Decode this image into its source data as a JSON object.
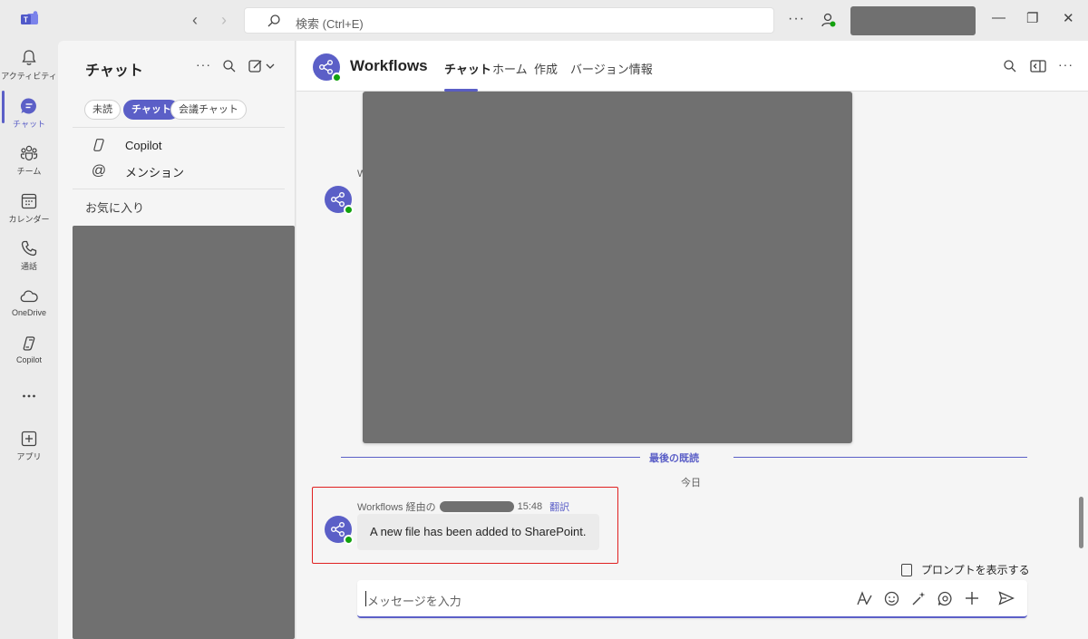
{
  "titlebar": {
    "search_placeholder": "検索 (Ctrl+E)",
    "more": "···",
    "minimize": "—",
    "restore": "❐",
    "close": "✕"
  },
  "rail": {
    "items": [
      {
        "label": "アクティビティ",
        "icon": "bell-icon"
      },
      {
        "label": "チャット",
        "icon": "chat-icon",
        "active": true
      },
      {
        "label": "チーム",
        "icon": "teams-icon"
      },
      {
        "label": "カレンダー",
        "icon": "calendar-icon"
      },
      {
        "label": "通話",
        "icon": "phone-icon"
      },
      {
        "label": "OneDrive",
        "icon": "cloud-icon"
      },
      {
        "label": "Copilot",
        "icon": "copilot-icon"
      },
      {
        "label": "",
        "icon": "more-icon"
      },
      {
        "label": "アプリ",
        "icon": "apps-icon"
      }
    ]
  },
  "panel": {
    "title": "チャット",
    "filters": [
      "未読",
      "チャット",
      "会議チャット"
    ],
    "special": [
      {
        "label": "Copilot",
        "icon": "copilot-icon"
      },
      {
        "label": "メンション",
        "icon": "at-icon"
      }
    ],
    "favorites_label": "お気に入り"
  },
  "main": {
    "title": "Workflows",
    "tabs": [
      "チャット",
      "ホーム",
      "作成",
      "バージョン情報"
    ],
    "stray_text": "W",
    "last_read_label": "最後の既読",
    "today_label": "今日",
    "message": {
      "sender_prefix": "Workflows 経由の",
      "time": "15:48",
      "translate": "翻訳",
      "text": "A new file has been added to SharePoint."
    },
    "show_prompts": "プロンプトを表示する",
    "compose_placeholder": "メッセージを入力"
  },
  "colors": {
    "accent": "#5b5fc7",
    "presence": "#13a10e",
    "highlight": "#e02020",
    "redacted": "#707070"
  }
}
